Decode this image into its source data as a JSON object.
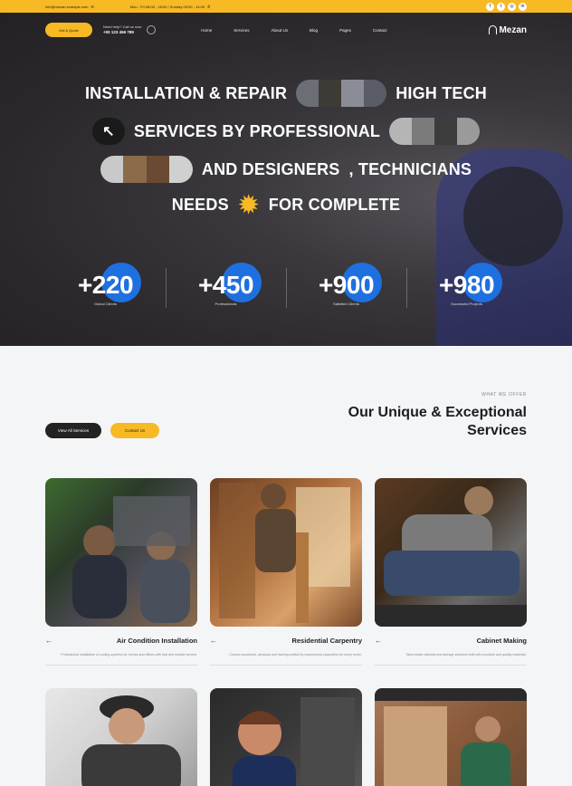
{
  "topbar": {
    "left_text": "info@mezan.example.com",
    "center_text": "Mon - Fri 08:00 - 18:00 / Sunday 09:00 - 14:00",
    "socials": [
      "facebook-icon",
      "twitter-icon",
      "instagram-icon",
      "linkedin-icon"
    ]
  },
  "nav": {
    "quote_button": "Get A Quote",
    "phone_label": "Need help? Call us now",
    "phone_number": "+00 123 456 789",
    "menu": [
      "Home",
      "Services",
      "About Us",
      "Blog",
      "Pages",
      "Contact"
    ],
    "logo_text": "Mezan"
  },
  "hero": {
    "line1_a": "INSTALLATION & REPAIR",
    "line1_b": "HIGH TECH",
    "line2": "SERVICES BY PROFESSIONAL",
    "line3_a": "AND DESIGNERS",
    "line3_b": ", TECHNICIANS",
    "line4_a": "NEEDS",
    "line4_b": "FOR COMPLETE",
    "stats": [
      {
        "value": "+220",
        "label": "Global Clients"
      },
      {
        "value": "+450",
        "label": "Professionals"
      },
      {
        "value": "+900",
        "label": "Satisfied Clients"
      },
      {
        "value": "+980",
        "label": "Successful Projects"
      }
    ]
  },
  "services": {
    "tag": "WHAT WE OFFER",
    "title": "Our Unique & Exceptional Services",
    "button_dark": "View All Services",
    "button_yellow": "Contact Us",
    "cards": [
      {
        "title": "Air Condition Installation",
        "desc": "Professional installation of cooling systems for homes and offices with fast and reliable service."
      },
      {
        "title": "Residential Carpentry",
        "desc": "Custom woodwork, windows and framing crafted by experienced carpenters for every home."
      },
      {
        "title": "Cabinet Making",
        "desc": "Tailor-made cabinets and storage solutions built with precision and quality materials."
      }
    ]
  },
  "colors": {
    "accent": "#f7b924",
    "blue": "#1e70e0",
    "dark": "#232323"
  }
}
